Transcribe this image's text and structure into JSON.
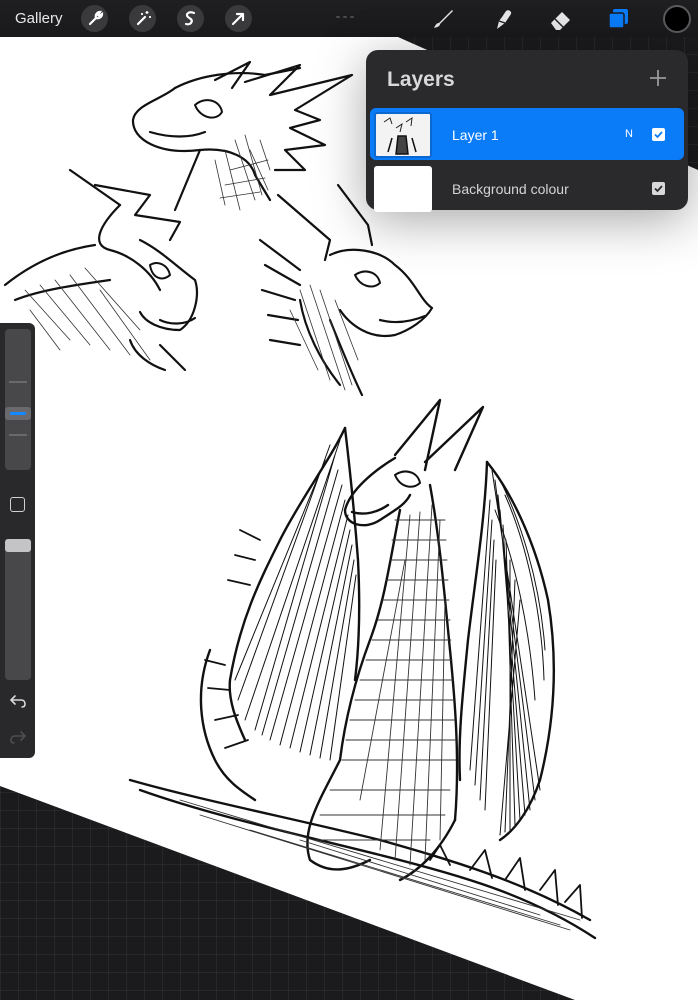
{
  "toolbar": {
    "gallery_label": "Gallery",
    "action_icons": [
      "wrench-icon",
      "magic-wand-icon",
      "selection-icon",
      "transform-arrow-icon"
    ],
    "tool_icons": [
      "brush-icon",
      "smudge-icon",
      "eraser-icon",
      "layers-icon"
    ],
    "active_tool": "layers",
    "active_color": "#000000",
    "accent_color": "#0a7cf8"
  },
  "layers_panel": {
    "title": "Layers",
    "add_icon": "plus-icon",
    "layers": [
      {
        "name": "Layer 1",
        "blend_mode": "N",
        "visible": true,
        "selected": true
      },
      {
        "name": "Background colour",
        "visible": true,
        "selected": false
      }
    ]
  },
  "sidebar": {
    "modify_icon": "square-icon",
    "undo_icon": "undo-icon",
    "redo_icon": "redo-icon",
    "redo_enabled": false
  }
}
